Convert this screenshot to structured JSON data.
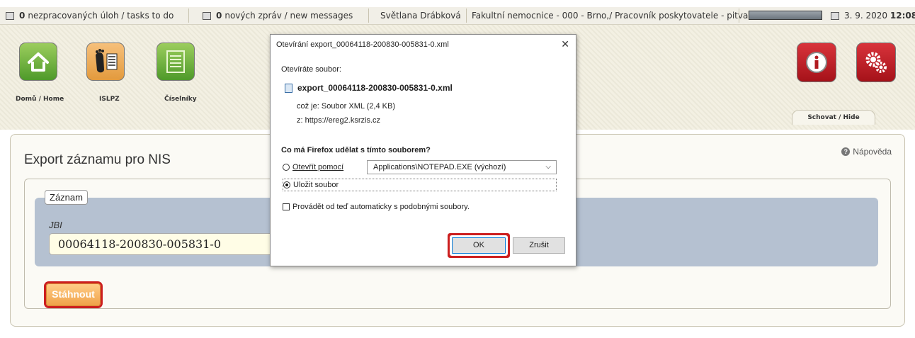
{
  "topbar": {
    "tasks_count": "0",
    "tasks_label": "nezpracovaných úloh / tasks to do",
    "messages_count": "0",
    "messages_label": "nových zpráv / new messages",
    "user_name": "Světlana Drábková",
    "organization": "Fakultní nemocnice - 000 - Brno,/ Pracovník poskytovatele - pitva",
    "date": "3. 9. 2020",
    "time": "12:08"
  },
  "header": {
    "nav": [
      {
        "label": "Domů / Home",
        "icon": "home-icon"
      },
      {
        "label": "ISLPZ",
        "icon": "foot-id-icon"
      },
      {
        "label": "Číselníky",
        "icon": "code-list-icon"
      }
    ],
    "hide_label": "Schovat / Hide",
    "info_icon": "info-icon",
    "settings_icon": "settings-gears-icon"
  },
  "main": {
    "title": "Export záznamu pro NIS",
    "help_label": "Nápověda",
    "legend": "Záznam",
    "jbi_label": "JBI",
    "jbi_value": "00064118-200830-005831-0",
    "download_label": "Stáhnout"
  },
  "dialog": {
    "title": "Otevírání export_00064118-200830-005831-0.xml",
    "opening_label": "Otevíráte soubor:",
    "file_name": "export_00064118-200830-005831-0.xml",
    "type_prefix": "což je:",
    "type_value": "Soubor XML (2,4 KB)",
    "from_prefix": "z:",
    "from_value": "https://ereg2.ksrzis.cz",
    "question": "Co má Firefox udělat s tímto souborem?",
    "open_with_label": "Otevřít pomocí",
    "open_with_app": "Applications\\NOTEPAD.EXE (výchozí)",
    "save_label": "Uložit soubor",
    "auto_label": "Provádět od teď automaticky s podobnými soubory.",
    "selected_option": "save",
    "ok_label": "OK",
    "cancel_label": "Zrušit"
  },
  "colors": {
    "accent_highlight": "#cc1f1f",
    "record_box": "#b5c1d1",
    "download_button": "#f0a24a"
  }
}
